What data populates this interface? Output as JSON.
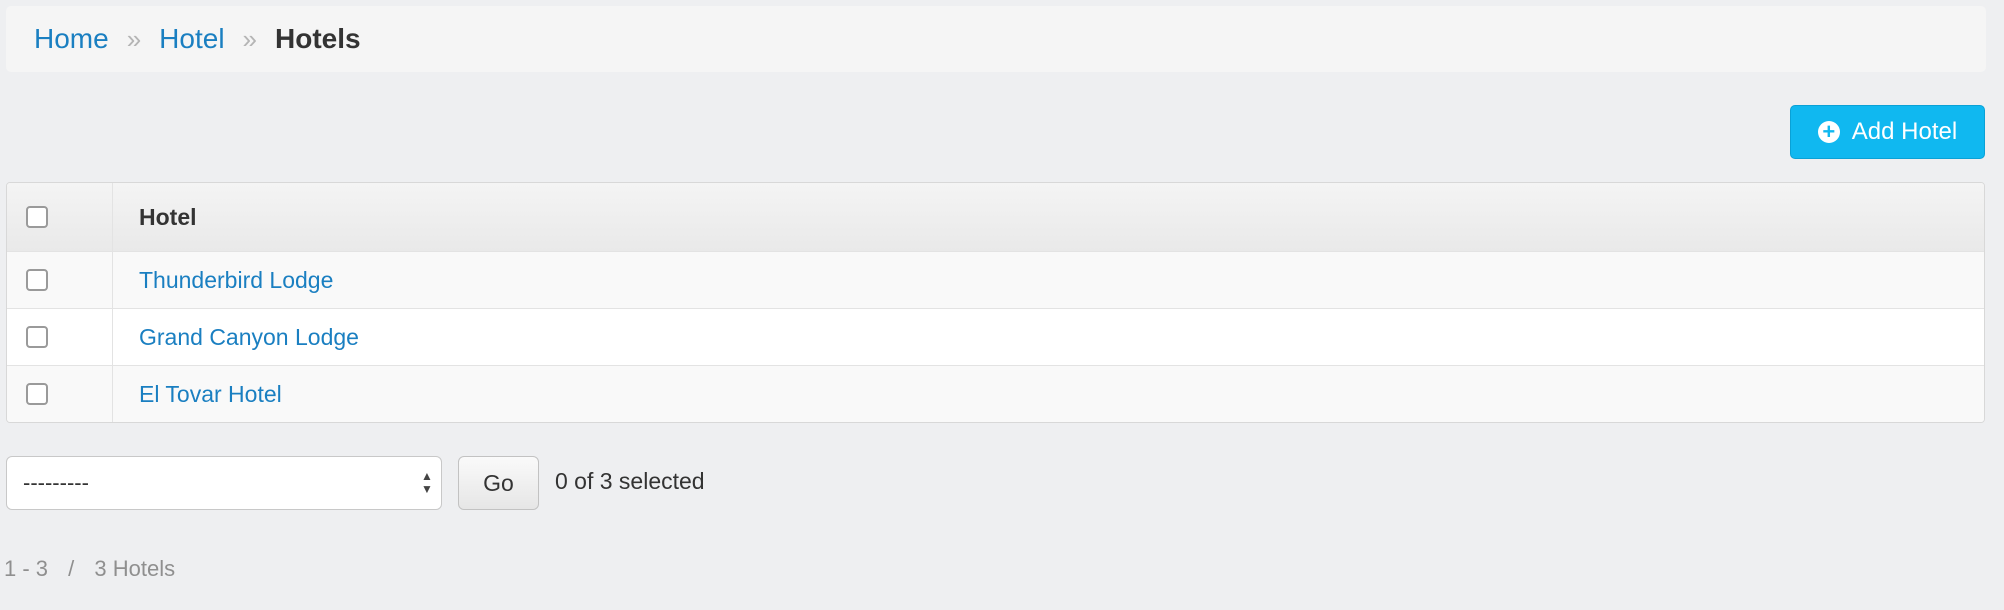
{
  "breadcrumb": {
    "home": "Home",
    "separator": "»",
    "app": "Hotel",
    "current": "Hotels"
  },
  "toolbar": {
    "add_label": "Add Hotel",
    "add_icon": "plus-circle-icon"
  },
  "table": {
    "column_header": "Hotel",
    "rows": [
      {
        "name": "Thunderbird Lodge"
      },
      {
        "name": "Grand Canyon Lodge"
      },
      {
        "name": "El Tovar Hotel"
      }
    ]
  },
  "actions": {
    "select_value": "---------",
    "go_label": "Go",
    "selected_text": "0 of 3 selected"
  },
  "pagination": {
    "range": "1 - 3",
    "separator": "/",
    "total": "3 Hotels"
  },
  "colors": {
    "link": "#1a7fc1",
    "add_button": "#10b8f0",
    "background": "#eeeff1"
  }
}
